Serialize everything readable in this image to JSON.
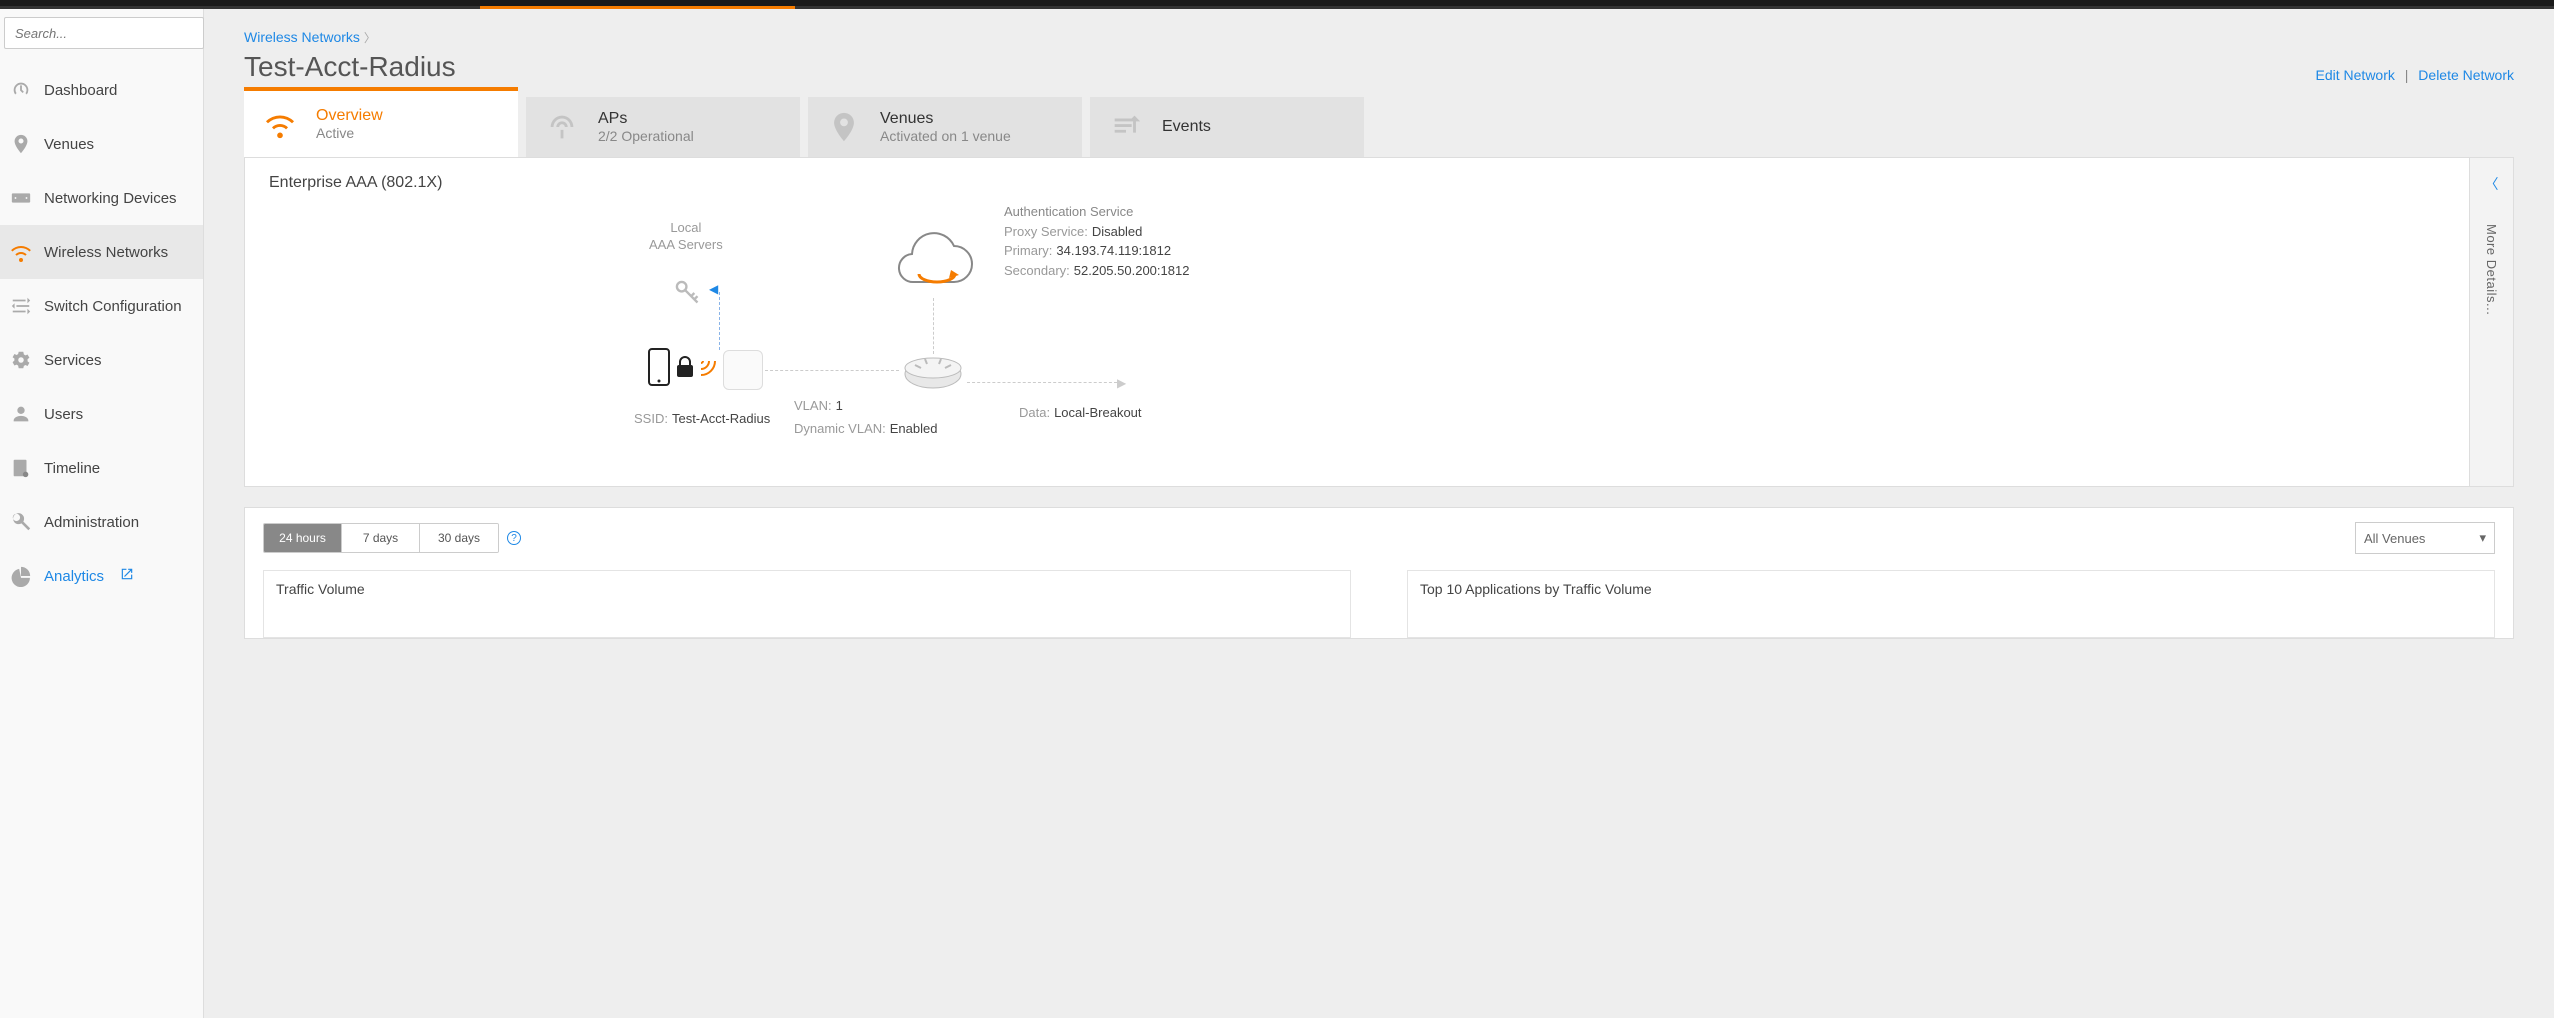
{
  "search": {
    "placeholder": "Search..."
  },
  "sidebar": {
    "items": [
      {
        "label": "Dashboard"
      },
      {
        "label": "Venues"
      },
      {
        "label": "Networking Devices"
      },
      {
        "label": "Wireless Networks"
      },
      {
        "label": "Switch Configuration"
      },
      {
        "label": "Services"
      },
      {
        "label": "Users"
      },
      {
        "label": "Timeline"
      },
      {
        "label": "Administration"
      },
      {
        "label": "Analytics"
      }
    ]
  },
  "breadcrumb": {
    "parent": "Wireless Networks"
  },
  "header": {
    "title": "Test-Acct-Radius",
    "edit": "Edit Network",
    "delete": "Delete Network"
  },
  "tabs": {
    "overview": {
      "title": "Overview",
      "sub": "Active"
    },
    "aps": {
      "title": "APs",
      "sub": "2/2 Operational"
    },
    "venues": {
      "title": "Venues",
      "sub": "Activated on 1 venue"
    },
    "events": {
      "title": "Events",
      "sub": ""
    }
  },
  "panel": {
    "title": "Enterprise AAA (802.1X)",
    "more": "More Details...",
    "local_aaa_line1": "Local",
    "local_aaa_line2": "AAA Servers",
    "auth": {
      "heading": "Authentication Service",
      "proxy_label": "Proxy Service:",
      "proxy_value": "Disabled",
      "primary_label": "Primary:",
      "primary_value": "34.193.74.119:1812",
      "secondary_label": "Secondary:",
      "secondary_value": "52.205.50.200:1812"
    },
    "ssid_label": "SSID:",
    "ssid_value": "Test-Acct-Radius",
    "vlan_label": "VLAN:",
    "vlan_value": "1",
    "dyn_label": "Dynamic VLAN:",
    "dyn_value": "Enabled",
    "data_label": "Data:",
    "data_value": "Local-Breakout"
  },
  "volume": {
    "ranges": [
      "24 hours",
      "7 days",
      "30 days"
    ],
    "venue_filter": "All Venues",
    "card1_title": "Traffic Volume",
    "card2_title": "Top 10 Applications by Traffic Volume"
  }
}
